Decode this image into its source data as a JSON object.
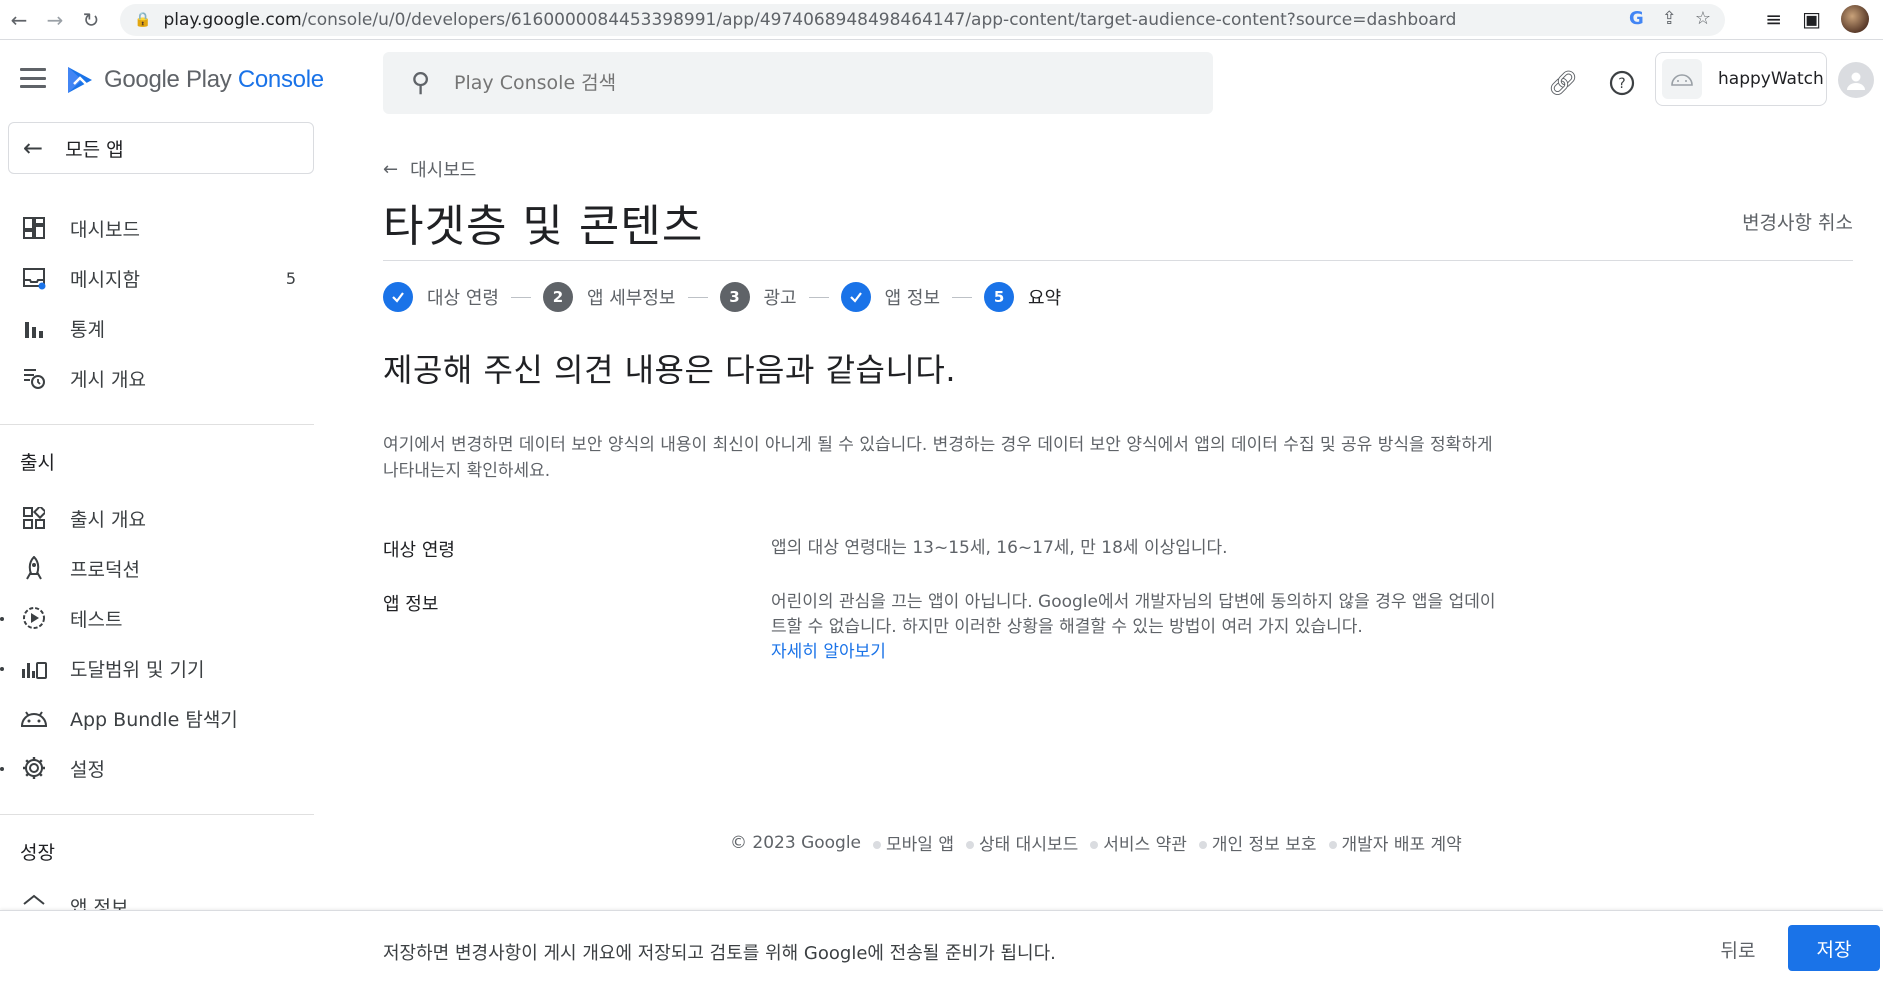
{
  "browser": {
    "url_domain": "play.google.com",
    "url_path": "/console/u/0/developers/6160000084453398991/app/4974068948498464147/app-content/target-audience-content?source=dashboard"
  },
  "header": {
    "logo_google_play": "Google Play",
    "logo_console": "Console",
    "search_placeholder": "Play Console 검색",
    "app_name": "happyWatch"
  },
  "sidebar": {
    "all_apps": "모든 앱",
    "items_top": [
      {
        "label": "대시보드",
        "icon": "dashboard-icon"
      },
      {
        "label": "메시지함",
        "icon": "inbox-icon",
        "badge": "5"
      },
      {
        "label": "통계",
        "icon": "bar-chart-icon"
      },
      {
        "label": "게시 개요",
        "icon": "publishing-overview-icon"
      }
    ],
    "section_release": "출시",
    "items_release": [
      {
        "label": "출시 개요",
        "icon": "release-overview-icon"
      },
      {
        "label": "프로덕션",
        "icon": "production-icon"
      },
      {
        "label": "테스트",
        "icon": "testing-icon"
      },
      {
        "label": "도달범위 및 기기",
        "icon": "reach-devices-icon"
      },
      {
        "label": "App Bundle 탐색기",
        "icon": "android-icon"
      },
      {
        "label": "설정",
        "icon": "settings-icon"
      }
    ],
    "section_grow": "성장",
    "item_grow_partial": "앱 정보"
  },
  "main": {
    "back_label": "대시보드",
    "title": "타겟층 및 콘텐츠",
    "discard_label": "변경사항 취소",
    "steps": [
      {
        "num": "1",
        "label": "대상 연령",
        "state": "done"
      },
      {
        "num": "2",
        "label": "앱 세부정보",
        "state": "todo"
      },
      {
        "num": "3",
        "label": "광고",
        "state": "todo"
      },
      {
        "num": "4",
        "label": "앱 정보",
        "state": "done"
      },
      {
        "num": "5",
        "label": "요약",
        "state": "active"
      }
    ],
    "summary_heading": "제공해 주신 의견 내용은 다음과 같습니다.",
    "info_text": "여기에서 변경하면 데이터 보안 양식의 내용이 최신이 아니게 될 수 있습니다. 변경하는 경우 데이터 보안 양식에서 앱의 데이터 수집 및 공유 방식을 정확하게 나타내는지 확인하세요.",
    "rows": [
      {
        "label": "대상 연령",
        "value": "앱의 대상 연령대는 13~15세, 16~17세, 만 18세 이상입니다."
      },
      {
        "label": "앱 정보",
        "value": "어린이의 관심을 끄는 앱이 아닙니다. Google에서 개발자님의 답변에 동의하지 않을 경우 앱을 업데이트할 수 없습니다. 하지만 이러한 상황을 해결할 수 있는 방법이 여러 가지 있습니다.",
        "link": "자세히 알아보기"
      }
    ]
  },
  "footer": {
    "copyright": "© 2023 Google",
    "links": [
      "모바일 앱",
      "상태 대시보드",
      "서비스 약관",
      "개인 정보 보호",
      "개발자 배포 계약"
    ]
  },
  "bottombar": {
    "message": "저장하면 변경사항이 게시 개요에 저장되고 검토를 위해 Google에 전송될 준비가 됩니다.",
    "back_label": "뒤로",
    "save_label": "저장"
  },
  "colors": {
    "accent": "#1a73e8",
    "step_todo": "#5f6368"
  }
}
